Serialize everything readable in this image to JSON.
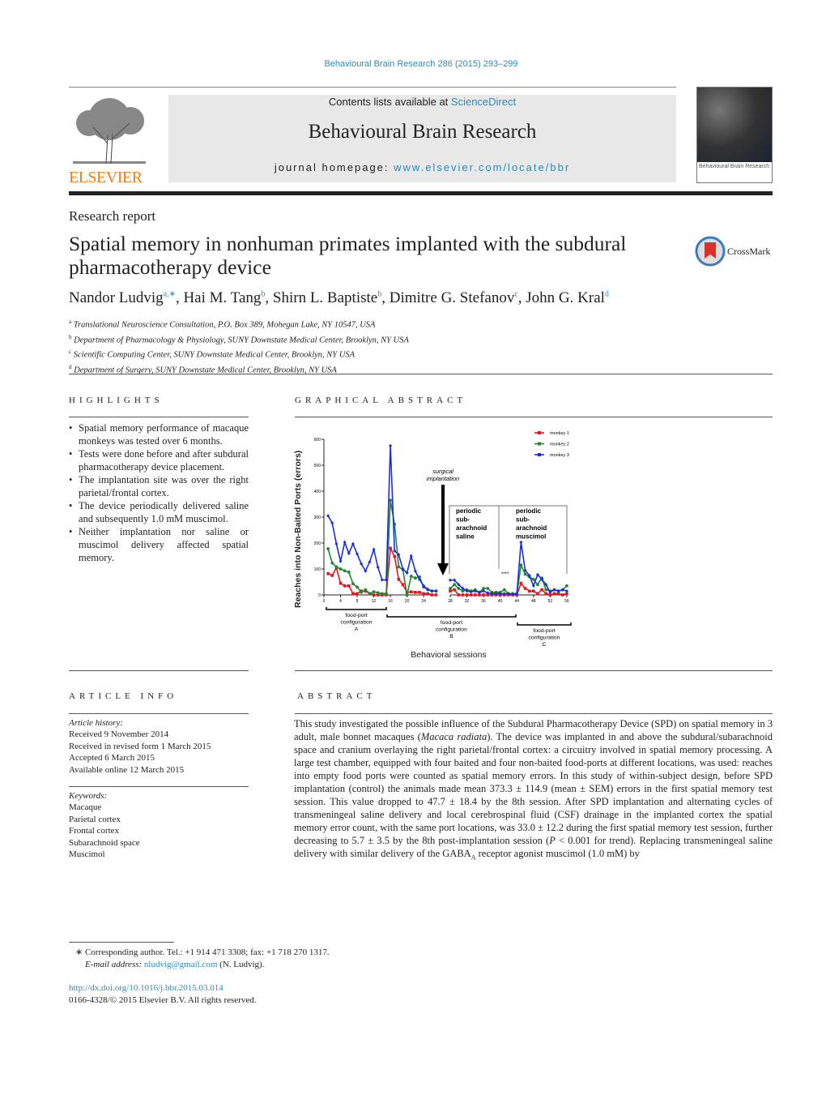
{
  "citation": "Behavioural Brain Research 286 (2015) 293–299",
  "header": {
    "contents_prefix": "Contents lists available at ",
    "contents_link": "ScienceDirect",
    "journal": "Behavioural Brain Research",
    "homepage_prefix": "journal homepage: ",
    "homepage_link": "www.elsevier.com/locate/bbr",
    "publisher": "ELSEVIER",
    "cover_text": "Behavioural Brain Research"
  },
  "article": {
    "type": "Research report",
    "title": "Spatial memory in nonhuman primates implanted with the subdural pharmacotherapy device",
    "crossmark": "CrossMark",
    "authors": [
      {
        "name": "Nandor Ludvig",
        "sup": "a,∗"
      },
      {
        "name": "Hai M. Tang",
        "sup": "b"
      },
      {
        "name": "Shirn L. Baptiste",
        "sup": "b"
      },
      {
        "name": "Dimitre G. Stefanov",
        "sup": "c"
      },
      {
        "name": "John G. Kral",
        "sup": "d"
      }
    ],
    "affiliations": [
      {
        "sup": "a",
        "text": "Translational Neuroscience Consultation, P.O. Box 389, Mohegan Lake, NY 10547, USA"
      },
      {
        "sup": "b",
        "text": "Department of Pharmacology & Physiology, SUNY Downstate Medical Center, Brooklyn, NY USA"
      },
      {
        "sup": "c",
        "text": "Scientific Computing Center, SUNY Downstate Medical Center, Brooklyn, NY USA"
      },
      {
        "sup": "d",
        "text": "Department of Surgery, SUNY Downstate Medical Center, Brooklyn, NY USA"
      }
    ]
  },
  "highlights": {
    "heading": "HIGHLIGHTS",
    "items": [
      "Spatial memory performance of macaque monkeys was tested over 6 months.",
      "Tests were done before and after subdural pharmacotherapy device placement.",
      "The implantation site was over the right parietal/frontal cortex.",
      "The device periodically delivered saline and subsequently 1.0 mM muscimol.",
      "Neither implantation nor saline or muscimol delivery affected spatial memory."
    ]
  },
  "graphical_abstract": {
    "heading": "GRAPHICAL ABSTRACT"
  },
  "chart_data": {
    "type": "line",
    "xlabel": "Behavioral sessions",
    "ylabel": "Reaches into Non-Baited Ports (errors)",
    "ylim": [
      0,
      600
    ],
    "yticks": [
      "0",
      "100",
      "200",
      "300",
      "400",
      "500",
      "600"
    ],
    "xticks": [
      "0",
      "4",
      "8",
      "12",
      "16",
      "20",
      "24",
      "28",
      "32",
      "36",
      "40",
      "44",
      "48",
      "52",
      "56"
    ],
    "xlim": [
      0,
      56
    ],
    "axis_break": [
      27,
      28
    ],
    "legend": "top-right",
    "series": [
      {
        "name": "monkey 1",
        "color": "#e8141b",
        "marker": "square",
        "x": [
          1,
          2,
          3,
          4,
          5,
          6,
          7,
          8,
          9,
          10,
          11,
          12,
          13,
          14,
          15,
          16,
          17,
          18,
          19,
          20,
          21,
          22,
          23,
          24,
          25,
          26,
          27,
          28,
          29,
          30,
          31,
          32,
          33,
          34,
          35,
          36,
          37,
          38,
          39,
          40,
          41,
          42,
          43,
          44,
          45,
          46,
          47,
          48,
          49,
          50,
          51,
          52,
          53,
          54,
          55,
          56
        ],
        "values": [
          82,
          75,
          105,
          45,
          35,
          35,
          5,
          5,
          15,
          15,
          5,
          0,
          0,
          0,
          0,
          180,
          148,
          60,
          40,
          10,
          12,
          10,
          10,
          5,
          5,
          0,
          0,
          15,
          20,
          0,
          0,
          0,
          0,
          0,
          0,
          0,
          0,
          0,
          0,
          0,
          0,
          0,
          0,
          0,
          45,
          25,
          15,
          15,
          5,
          20,
          5,
          0,
          5,
          5,
          0,
          5
        ]
      },
      {
        "name": "monkey 2",
        "color": "#1e8a2a",
        "marker": "circle",
        "x": [
          1,
          2,
          3,
          4,
          5,
          6,
          7,
          8,
          9,
          10,
          11,
          12,
          13,
          14,
          15,
          16,
          17,
          18,
          19,
          20,
          21,
          22,
          23,
          24,
          25,
          26,
          27,
          28,
          29,
          30,
          31,
          32,
          33,
          34,
          35,
          36,
          37,
          38,
          39,
          40,
          41,
          42,
          43,
          44,
          45,
          46,
          47,
          48,
          49,
          50,
          51,
          52,
          53,
          54,
          55,
          56
        ],
        "values": [
          178,
          123,
          108,
          100,
          93,
          88,
          43,
          30,
          10,
          20,
          5,
          12,
          8,
          5,
          5,
          365,
          272,
          108,
          98,
          0,
          72,
          65,
          70,
          30,
          20,
          15,
          15,
          25,
          40,
          25,
          15,
          20,
          15,
          20,
          10,
          25,
          25,
          10,
          10,
          10,
          20,
          5,
          5,
          5,
          115,
          80,
          70,
          60,
          40,
          65,
          20,
          15,
          20,
          15,
          20,
          35
        ]
      },
      {
        "name": "monkey 3",
        "color": "#1a2ee0",
        "marker": "diamond",
        "x": [
          1,
          2,
          3,
          4,
          5,
          6,
          7,
          8,
          9,
          10,
          11,
          12,
          13,
          14,
          15,
          16,
          17,
          18,
          19,
          20,
          21,
          22,
          23,
          24,
          25,
          26,
          27,
          28,
          29,
          30,
          31,
          32,
          33,
          34,
          35,
          36,
          37,
          38,
          39,
          40,
          41,
          42,
          43,
          44,
          45,
          46,
          47,
          48,
          49,
          50,
          51,
          52,
          53,
          54,
          55,
          56
        ],
        "values": [
          305,
          277,
          197,
          130,
          203,
          160,
          197,
          158,
          120,
          92,
          127,
          175,
          107,
          58,
          58,
          575,
          170,
          155,
          100,
          85,
          150,
          92,
          60,
          35,
          22,
          15,
          15,
          57,
          57,
          40,
          25,
          15,
          12,
          15,
          10,
          15,
          8,
          5,
          5,
          5,
          5,
          5,
          3,
          3,
          203,
          95,
          75,
          35,
          78,
          60,
          40,
          10,
          20,
          15,
          20,
          15
        ]
      }
    ],
    "annotations": {
      "surgery": [
        "surgical",
        "implantation"
      ],
      "saline": [
        "periodic",
        "sub-",
        "arachnoid",
        "saline"
      ],
      "muscimol": [
        "periodic",
        "sub-",
        "arachnoid",
        "muscimol"
      ],
      "significance": "****",
      "config_a": [
        "food-port",
        "configuration",
        "A"
      ],
      "config_b": [
        "food-port",
        "configuration",
        "B"
      ],
      "config_c": [
        "food-port",
        "configuration",
        "C"
      ]
    }
  },
  "article_info": {
    "heading": "ARTICLE INFO",
    "history_label": "Article history:",
    "history": [
      "Received 9 November 2014",
      "Received in revised form 1 March 2015",
      "Accepted 6 March 2015",
      "Available online 12 March 2015"
    ],
    "keywords_label": "Keywords:",
    "keywords": [
      "Macaque",
      "Parietal cortex",
      "Frontal cortex",
      "Subarachnoid space",
      "Muscimol"
    ]
  },
  "abstract": {
    "heading": "ABSTRACT",
    "p1": "This study investigated the possible influence of the Subdural Pharmacotherapy Device (SPD) on spatial memory in 3 adult, male bonnet macaques (",
    "species": "Macaca radiata",
    "p2": "). The device was implanted in and above the subdural/subarachnoid space and cranium overlaying the right parietal/frontal cortex: a circuitry involved in spatial memory processing. A large test chamber, equipped with four baited and four non-baited food-ports at different locations, was used: reaches into empty food ports were counted as spatial memory errors. In this study of within-subject design, before SPD implantation (control) the animals made mean 373.3 ± 114.9 (mean ± SEM) errors in the first spatial memory test session. This value dropped to 47.7 ± 18.4 by the 8th session. After SPD implantation and alternating cycles of transmeningeal saline delivery and local cerebrospinal fluid (CSF) drainage in the implanted cortex the spatial memory error count, with the same port locations, was 33.0 ± 12.2 during the first spatial memory test session, further decreasing to 5.7 ± 3.5 by the 8th post-implantation session (",
    "p_italic": "P",
    "p3": " < 0.001 for trend). Replacing transmeningeal saline delivery with similar delivery of the GABA",
    "sub": "A",
    "p4": " receptor agonist muscimol (1.0 mM) by"
  },
  "footer": {
    "corresponding": "∗ Corresponding author. Tel.: +1 914 471 3308; fax: +1 718 270 1317.",
    "email_label": "E-mail address: ",
    "email": "nludvig@gmail.com",
    "email_suffix": " (N. Ludvig).",
    "doi": "http://dx.doi.org/10.1016/j.bbr.2015.03.014",
    "copyright": "0166-4328/© 2015 Elsevier B.V. All rights reserved."
  }
}
